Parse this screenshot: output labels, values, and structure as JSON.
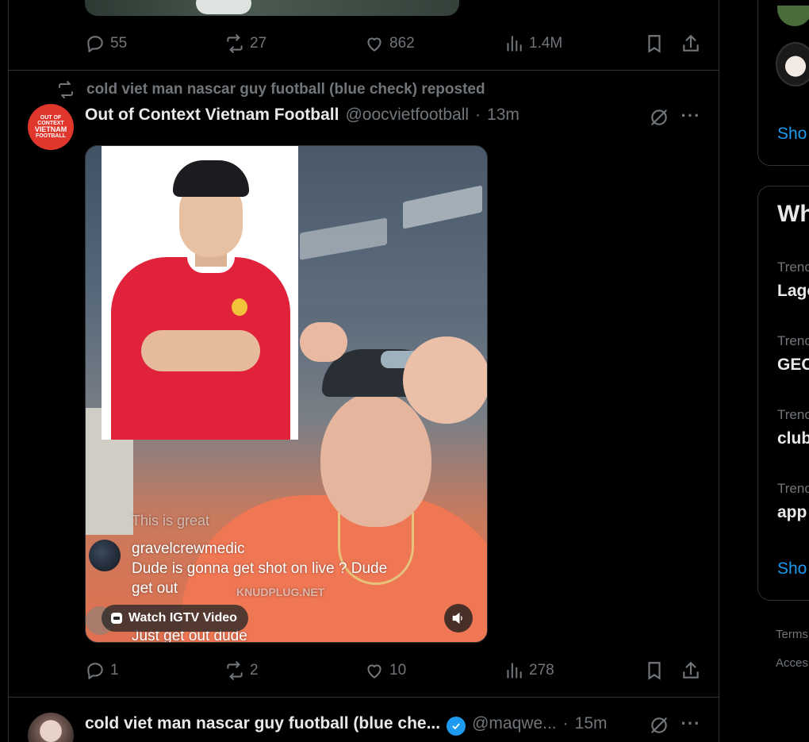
{
  "prev_tweet": {
    "replies": "55",
    "reposts": "27",
    "likes": "862",
    "views": "1.4M"
  },
  "tweet": {
    "repost_note": "cold viet man nascar guy fuotball (blue check) reposted",
    "avatar_lines": [
      "OUT OF CONTEXT",
      "VIETNAM",
      "FOOTBALL"
    ],
    "display_name": "Out of Context Vietnam Football",
    "handle": "@oocvietfootball",
    "separator": "·",
    "time": "13m",
    "media": {
      "overlay_comment_faded": "This is great",
      "commenter": "gravelcrewmedic",
      "comment_line1": "Dude is gonna get shot on live ? Dude",
      "comment_line2": "get out",
      "comment_line3": "Just get out dude",
      "watermark": "KNUDPLUG.NET",
      "igtv_label": "Watch IGTV Video"
    },
    "replies": "1",
    "reposts": "2",
    "likes": "10",
    "views": "278"
  },
  "next_tweet": {
    "display_name": "cold viet man nascar guy fuotball (blue che...",
    "handle": "@maqwe...",
    "separator": "·",
    "time": "15m"
  },
  "sidebar": {
    "show_more_1": "Sho",
    "section_title": "Wh",
    "trends": [
      {
        "label": "Trenc",
        "name": "Lago"
      },
      {
        "label": "Trenc",
        "name": "GEC"
      },
      {
        "label": "Trenc",
        "name": "club"
      },
      {
        "label": "Trenc",
        "name": "app"
      }
    ],
    "show_more_2": "Sho",
    "footer_terms": "Terms",
    "footer_access": "Acces"
  },
  "colors": {
    "background": "#000000",
    "text": "#e7e9ea",
    "muted": "#71767b",
    "accent": "#1d9bf0",
    "border": "#2f3336",
    "avatar_red": "#e0362c"
  }
}
